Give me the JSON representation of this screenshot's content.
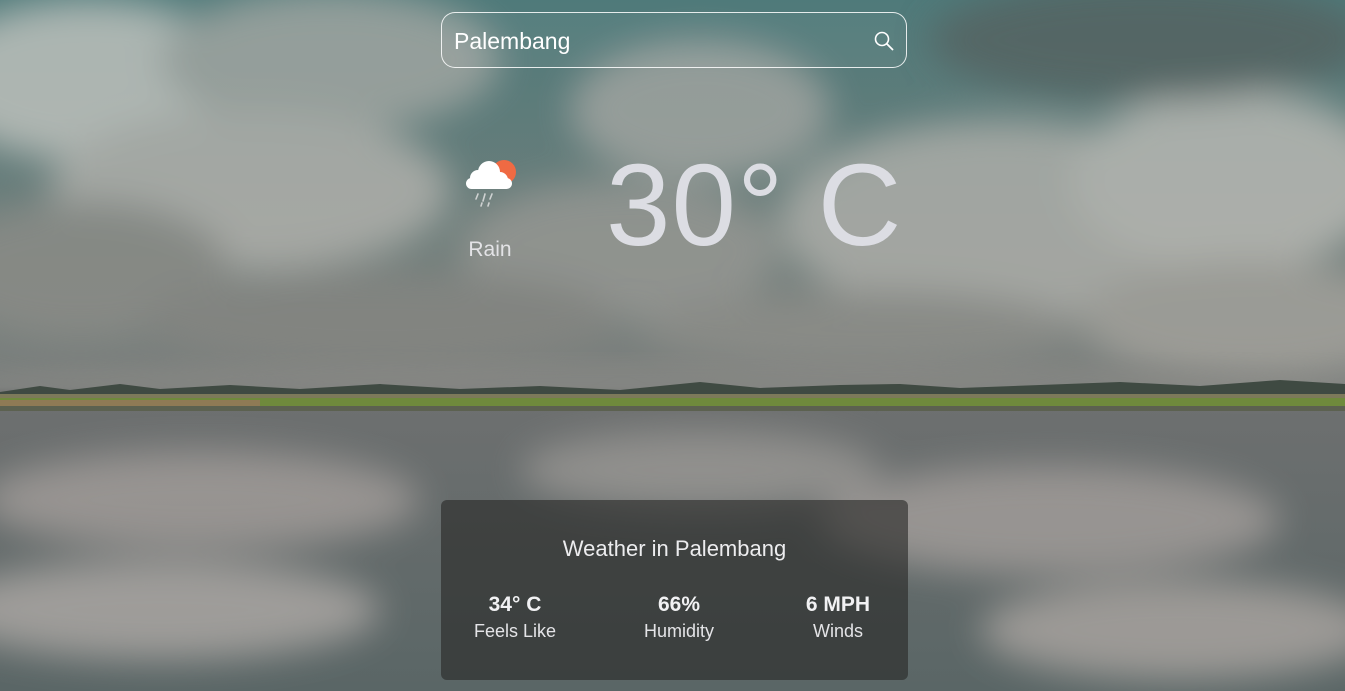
{
  "search": {
    "value": "Palembang",
    "icon": "search-icon"
  },
  "current": {
    "condition": "Rain",
    "condition_icon": "cloud-rain-sun-icon",
    "temperature": "30° C"
  },
  "details": {
    "title": "Weather in Palembang",
    "feels_like": {
      "value": "34° C",
      "label": "Feels Like"
    },
    "humidity": {
      "value": "66%",
      "label": "Humidity"
    },
    "winds": {
      "value": "6 MPH",
      "label": "Winds"
    }
  },
  "colors": {
    "sun": "#ef6a43",
    "cloud": "#ffffff",
    "card_bg": "rgba(40,40,38,0.62)"
  }
}
